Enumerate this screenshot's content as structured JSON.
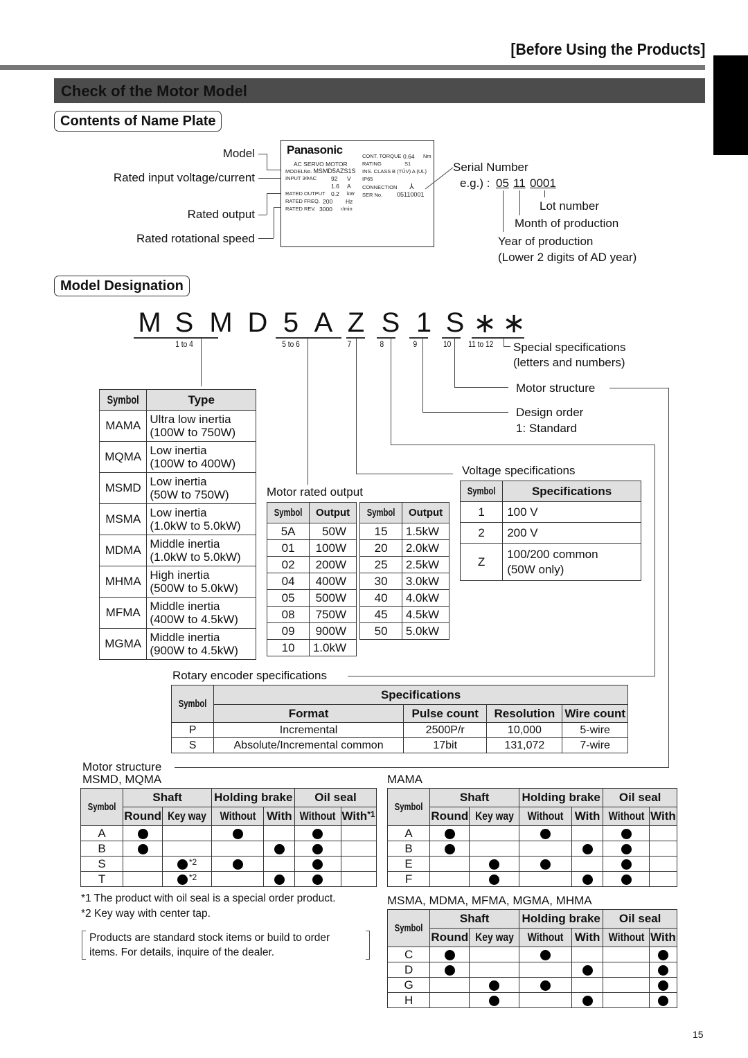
{
  "header": {
    "section_tag": "[Before Using the Products]",
    "banner_title": "Check of the Motor Model",
    "page_number": "15"
  },
  "nameplate_section": {
    "title": "Contents of Name Plate",
    "left_labels": [
      "Model",
      "Rated input voltage/current",
      "Rated output",
      "Rated rotational speed"
    ],
    "plate": {
      "brand": "Panasonic",
      "subtitle": "AC SERVO MOTOR",
      "model_label": "MODELNo.",
      "model_value": "MSMD5AZS1S",
      "input_label": "INPUT 3ΦAC",
      "input_voltage": "92",
      "input_voltage_unit": "V",
      "input_current": "1.6",
      "input_current_unit": "A",
      "rated_output_label": "RATED OUTPUT",
      "rated_output_value": "0.2",
      "rated_output_unit": "kW",
      "rated_freq_label": "RATED FREQ.",
      "rated_freq_value": "200",
      "rated_freq_unit": "Hz",
      "rated_rev_label": "RATED REV.",
      "rated_rev_value": "3000",
      "rated_rev_unit": "r/min",
      "cont_torque_label": "CONT. TORQUE",
      "cont_torque_value": "0.64",
      "cont_torque_unit": "Nm",
      "rating_label": "RATING",
      "rating_value": "S1",
      "ins_class_label": "INS. CLASS",
      "ins_class_value": "B (TÜV)   A (UL)",
      "ip_label": "IP65",
      "connection_label": "CONNECTION",
      "connection_symbol": "⅄",
      "ser_label": "SER No.",
      "ser_value": "05110001"
    },
    "serial": {
      "title": "Serial Number",
      "example_prefix": "e.g.) :",
      "year_digits": "05",
      "month_digits": "11",
      "lot_digits": "0001",
      "lot_label": "Lot number",
      "month_label": "Month of production",
      "year_label": "Year of production",
      "year_note": "(Lower 2 digits of AD year)"
    }
  },
  "designation": {
    "title": "Model Designation",
    "code_chars": [
      "M",
      "S",
      "M",
      "D",
      "5",
      "A",
      "Z",
      "S",
      "1",
      "S",
      "∗",
      "∗"
    ],
    "positions": [
      "1 to 4",
      "5 to 6",
      "7",
      "8",
      "9",
      "10",
      "11 to 12"
    ],
    "special_spec": "Special specifications",
    "special_spec_note": "(letters and numbers)",
    "motor_structure_label": "Motor structure",
    "design_order_label": "Design order",
    "design_order_note": "1: Standard",
    "voltage_spec_label": "Voltage specifications",
    "rated_output_label": "Motor rated output",
    "encoder_label": "Rotary encoder specifications"
  },
  "type_table": {
    "headers": [
      "Symbol",
      "Type"
    ],
    "rows": [
      {
        "symbol": "MAMA",
        "line1": "Ultra low inertia",
        "line2": "(100W to 750W)"
      },
      {
        "symbol": "MQMA",
        "line1": "Low inertia",
        "line2": "(100W to 400W)"
      },
      {
        "symbol": "MSMD",
        "line1": "Low inertia",
        "line2": "(50W to 750W)"
      },
      {
        "symbol": "MSMA",
        "line1": " Low inertia",
        "line2": "(1.0kW to 5.0kW)"
      },
      {
        "symbol": "MDMA",
        "line1": "Middle inertia",
        "line2": "(1.0kW to 5.0kW)"
      },
      {
        "symbol": "MHMA",
        "line1": "High inertia",
        "line2": "(500W to 5.0kW)"
      },
      {
        "symbol": "MFMA",
        "line1": "Middle inertia",
        "line2": "(400W to 4.5kW)"
      },
      {
        "symbol": "MGMA",
        "line1": "Middle inertia",
        "line2": "(900W to 4.5kW)"
      }
    ]
  },
  "output_table_1": {
    "headers": [
      "Symbol",
      "Output"
    ],
    "rows": [
      [
        "5A",
        "50W"
      ],
      [
        "01",
        "100W"
      ],
      [
        "02",
        "200W"
      ],
      [
        "04",
        "400W"
      ],
      [
        "05",
        "500W"
      ],
      [
        "08",
        "750W"
      ],
      [
        "09",
        "900W"
      ],
      [
        "10",
        "1.0kW"
      ]
    ]
  },
  "output_table_2": {
    "headers": [
      "Symbol",
      "Output"
    ],
    "rows": [
      [
        "15",
        "1.5kW"
      ],
      [
        "20",
        "2.0kW"
      ],
      [
        "25",
        "2.5kW"
      ],
      [
        "30",
        "3.0kW"
      ],
      [
        "40",
        "4.0kW"
      ],
      [
        "45",
        "4.5kW"
      ],
      [
        "50",
        "5.0kW"
      ]
    ]
  },
  "voltage_table": {
    "headers": [
      "Symbol",
      "Specifications"
    ],
    "rows": [
      {
        "symbol": "1",
        "line1": "100 V",
        "line2": ""
      },
      {
        "symbol": "2",
        "line1": "200 V",
        "line2": ""
      },
      {
        "symbol": "Z",
        "line1": "100/200 common",
        "line2": "(50W only)"
      }
    ]
  },
  "encoder_table": {
    "symbol_header": "Symbol",
    "group_header": "Specifications",
    "headers": [
      "Format",
      "Pulse count",
      "Resolution",
      "Wire count"
    ],
    "rows": [
      [
        "P",
        "Incremental",
        "2500P/r",
        "10,000",
        "5-wire"
      ],
      [
        "S",
        "Absolute/Incremental common",
        "17bit",
        "131,072",
        "7-wire"
      ]
    ]
  },
  "structure": {
    "label": "Motor structure",
    "group_headers": [
      "Shaft",
      "Holding brake",
      "Oil seal"
    ],
    "sub_headers": [
      "Round",
      "Key way",
      "Without",
      "With",
      "Without",
      "With"
    ],
    "symbol_header": "Symbol",
    "tables": [
      {
        "title": "MSMD, MQMA",
        "oil_with_note": "*1",
        "rows": [
          {
            "symbol": "A",
            "marks": [
              1,
              0,
              1,
              0,
              1,
              0
            ],
            "keyway_note": ""
          },
          {
            "symbol": "B",
            "marks": [
              1,
              0,
              0,
              1,
              1,
              0
            ],
            "keyway_note": ""
          },
          {
            "symbol": "S",
            "marks": [
              0,
              1,
              1,
              0,
              1,
              0
            ],
            "keyway_note": "*2"
          },
          {
            "symbol": "T",
            "marks": [
              0,
              1,
              0,
              1,
              1,
              0
            ],
            "keyway_note": "*2"
          }
        ]
      },
      {
        "title": "MAMA",
        "oil_with_note": "",
        "rows": [
          {
            "symbol": "A",
            "marks": [
              1,
              0,
              1,
              0,
              1,
              0
            ],
            "keyway_note": ""
          },
          {
            "symbol": "B",
            "marks": [
              1,
              0,
              0,
              1,
              1,
              0
            ],
            "keyway_note": ""
          },
          {
            "symbol": "E",
            "marks": [
              0,
              1,
              1,
              0,
              1,
              0
            ],
            "keyway_note": ""
          },
          {
            "symbol": "F",
            "marks": [
              0,
              1,
              0,
              1,
              1,
              0
            ],
            "keyway_note": ""
          }
        ]
      },
      {
        "title": "MSMA, MDMA, MFMA, MGMA, MHMA",
        "oil_with_note": "",
        "rows": [
          {
            "symbol": "C",
            "marks": [
              1,
              0,
              1,
              0,
              0,
              1
            ],
            "keyway_note": ""
          },
          {
            "symbol": "D",
            "marks": [
              1,
              0,
              0,
              1,
              0,
              1
            ],
            "keyway_note": ""
          },
          {
            "symbol": "G",
            "marks": [
              0,
              1,
              1,
              0,
              0,
              1
            ],
            "keyway_note": ""
          },
          {
            "symbol": "H",
            "marks": [
              0,
              1,
              0,
              1,
              0,
              1
            ],
            "keyway_note": ""
          }
        ]
      }
    ]
  },
  "footnotes": {
    "note1": "*1 The product with oil seal is a special order product.",
    "note2": "*2 Key way with center tap.",
    "bracket_line1": "Products are standard stock items or build to order",
    "bracket_line2": "items. For details, inquire of the dealer."
  }
}
